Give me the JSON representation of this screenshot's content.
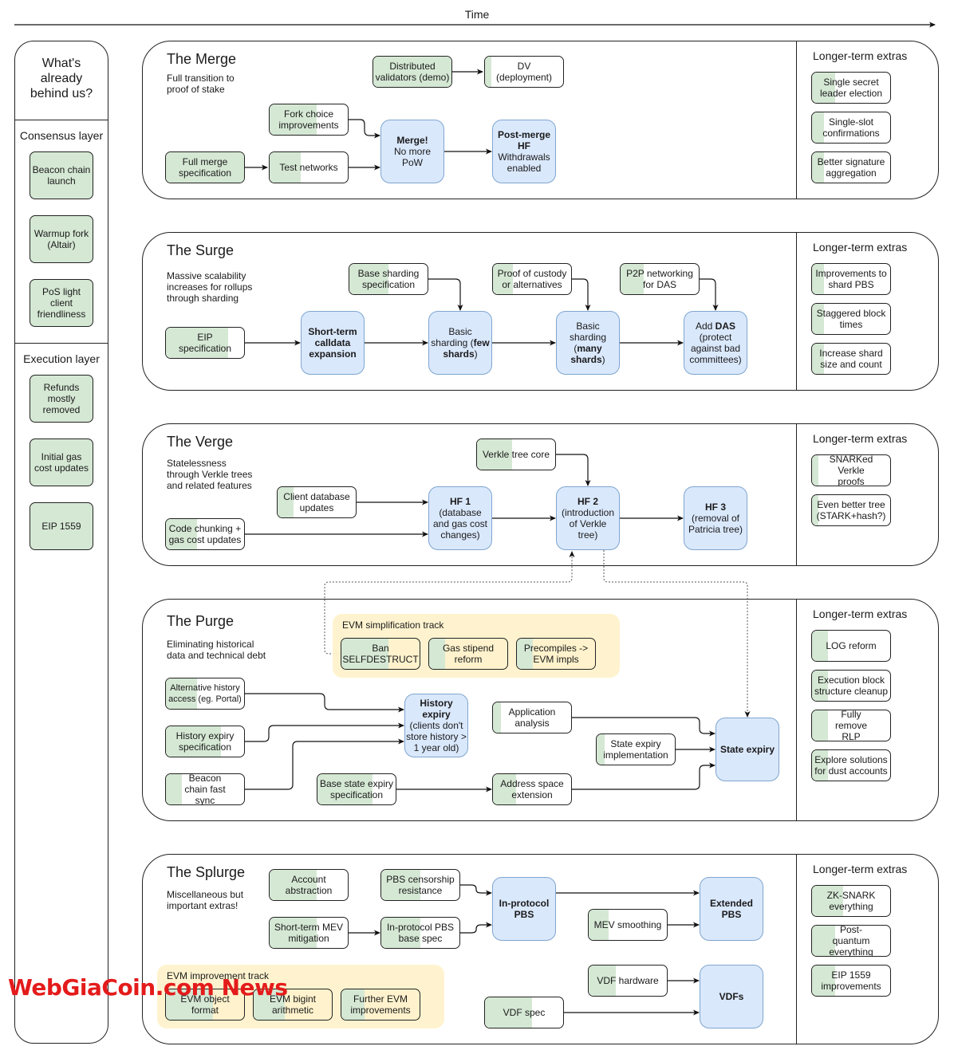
{
  "header": {
    "time_label": "Time"
  },
  "colors": {
    "done_green": "#d5e8d4",
    "milestone_blue": "#dae8fc",
    "track_yellow": "#fff2cc",
    "watermark_red": "#e41b1b"
  },
  "left_panel": {
    "title": "What's already behind us?",
    "consensus_label": "Consensus layer",
    "consensus_items": [
      "Beacon chain launch",
      "Warmup fork (Altair)",
      "PoS light client friendliness"
    ],
    "execution_label": "Execution layer",
    "execution_items": [
      "Refunds mostly removed",
      "Initial gas cost updates",
      "EIP 1559"
    ]
  },
  "longer_term_label": "Longer-term extras",
  "sections": {
    "merge": {
      "title": "The Merge",
      "subtitle": "Full transition to proof of stake",
      "nodes": {
        "dv_demo": {
          "label": "Distributed validators (demo)",
          "progress": 1.0
        },
        "dv_deploy": {
          "label": "DV (deployment)",
          "progress": 0.08
        },
        "fork_choice": {
          "label": "Fork choice improvements",
          "progress": 0.6
        },
        "full_spec": {
          "label": "Full merge specification",
          "progress": 1.0
        },
        "test_networks": {
          "label": "Test networks",
          "progress": 0.4
        }
      },
      "milestones": {
        "merge": {
          "bold": "Merge!",
          "rest": "No more PoW"
        },
        "post_merge": {
          "bold": "Post-merge HF",
          "rest": "Withdrawals enabled"
        }
      },
      "extras": [
        {
          "label": "Single secret leader election",
          "progress": 0.3
        },
        {
          "label": "Single-slot confirmations",
          "progress": 0.15
        },
        {
          "label": "Better signature aggregation",
          "progress": 0.15
        }
      ]
    },
    "surge": {
      "title": "The Surge",
      "subtitle": "Massive scalability increases for rollups through sharding",
      "nodes": {
        "eip_spec": {
          "label": "EIP specification",
          "progress": 0.8
        },
        "base_sharding": {
          "label": "Base sharding specification",
          "progress": 0.5
        },
        "proof_custody": {
          "label": "Proof of custody or alternatives",
          "progress": 0.25
        },
        "p2p_das": {
          "label": "P2P networking for DAS",
          "progress": 0.3
        }
      },
      "milestones": {
        "calldata": {
          "bold": "Short-term calldata expansion",
          "rest": ""
        },
        "few_shards": {
          "pre": "Basic sharding (",
          "bold": "few shards",
          "post": ")"
        },
        "many_shards": {
          "pre": "Basic sharding (",
          "bold": "many shards",
          "post": ")"
        },
        "das": {
          "pre": "Add ",
          "bold": "DAS",
          "post": " (protect against bad committees)"
        }
      },
      "extras": [
        {
          "label": "Improvements to shard PBS",
          "progress": 0.15
        },
        {
          "label": "Staggered block times",
          "progress": 0.15
        },
        {
          "label": "Increase shard size and count",
          "progress": 0.15
        }
      ]
    },
    "verge": {
      "title": "The Verge",
      "subtitle": "Statelessness through Verkle trees and related features",
      "nodes": {
        "verkle_core": {
          "label": "Verkle tree core",
          "progress": 0.45
        },
        "client_db": {
          "label": "Client database updates",
          "progress": 0.2
        },
        "code_chunking": {
          "label": "Code chunking + gas cost updates",
          "progress": 0.4
        }
      },
      "milestones": {
        "hf1": {
          "bold": "HF 1",
          "rest": "(database and gas cost changes)"
        },
        "hf2": {
          "bold": "HF 2",
          "rest": "(introduction of Verkle tree)"
        },
        "hf3": {
          "bold": "HF 3",
          "rest": "(removal of Patricia tree)"
        }
      },
      "extras": [
        {
          "label": "SNARKed Verkle proofs",
          "progress": 0.08
        },
        {
          "label": "Even better tree (STARK+hash?)",
          "progress": 0.08
        }
      ]
    },
    "purge": {
      "title": "The Purge",
      "subtitle": "Eliminating historical data and technical debt",
      "track_label": "EVM simplification track",
      "track_nodes": [
        {
          "label": "Ban SELFDESTRUCT",
          "progress": 0.6
        },
        {
          "label": "Gas stipend reform",
          "progress": 0.2
        },
        {
          "label": "Precompiles -> EVM impls",
          "progress": 0.2
        }
      ],
      "nodes": {
        "alt_history": {
          "label": "Alternative history access (eg. Portal)",
          "progress": 0.4
        },
        "history_spec": {
          "label": "History expiry specification",
          "progress": 0.7
        },
        "beacon_sync": {
          "label": "Beacon chain fast sync",
          "progress": 0.2
        },
        "base_state_spec": {
          "label": "Base state expiry specification",
          "progress": 0.7
        },
        "app_analysis": {
          "label": "Application analysis",
          "progress": 0.1
        },
        "state_impl": {
          "label": "State expiry implementation",
          "progress": 0.1
        },
        "address_space": {
          "label": "Address space extension",
          "progress": 0.3
        }
      },
      "milestones": {
        "history_expiry": {
          "bold": "History expiry",
          "rest": "(clients don't store history > 1 year old)"
        },
        "state_expiry": {
          "bold": "State expiry",
          "rest": ""
        }
      },
      "extras": [
        {
          "label": "LOG reform",
          "progress": 0.2
        },
        {
          "label": "Execution block structure cleanup",
          "progress": 0.2
        },
        {
          "label": "Fully remove RLP",
          "progress": 0.2
        },
        {
          "label": "Explore solutions for dust accounts",
          "progress": 0.2
        }
      ]
    },
    "splurge": {
      "title": "The Splurge",
      "subtitle": "Miscellaneous but important extras!",
      "track_label": "EVM improvement track",
      "track_nodes": [
        {
          "label": "EVM object format",
          "progress": 0.6
        },
        {
          "label": "EVM bigint arithmetic",
          "progress": 0.4
        },
        {
          "label": "Further EVM improvements",
          "progress": 0.3
        }
      ],
      "nodes": {
        "account_abstraction": {
          "label": "Account abstraction",
          "progress": 0.6
        },
        "pbs_censorship": {
          "label": "PBS censorship resistance",
          "progress": 0.5
        },
        "short_mev": {
          "label": "Short-term MEV mitigation",
          "progress": 0.6
        },
        "pbs_base": {
          "label": "In-protocol PBS base spec",
          "progress": 0.5
        },
        "mev_smoothing": {
          "label": "MEV smoothing",
          "progress": 0.25
        },
        "vdf_hardware": {
          "label": "VDF hardware",
          "progress": 0.35
        },
        "vdf_spec": {
          "label": "VDF spec",
          "progress": 0.6
        }
      },
      "milestones": {
        "in_protocol_pbs": {
          "bold": "In-protocol PBS",
          "rest": ""
        },
        "extended_pbs": {
          "bold": "Extended PBS",
          "rest": ""
        },
        "vdfs": {
          "bold": "VDFs",
          "rest": ""
        }
      },
      "extras": [
        {
          "label": "ZK-SNARK everything",
          "progress": 0.4
        },
        {
          "label": "Post-quantum everything",
          "progress": 0.3
        },
        {
          "label": "EIP 1559 improvements",
          "progress": 0.3
        }
      ]
    }
  },
  "watermark": "WebGiaCoin.com News"
}
